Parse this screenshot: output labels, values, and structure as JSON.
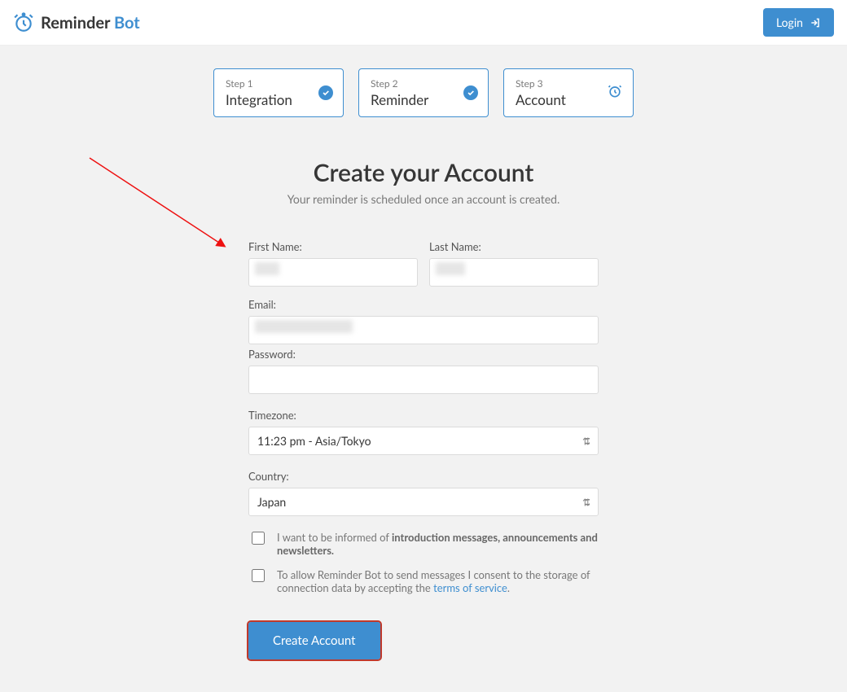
{
  "brand": {
    "name1": "Reminder",
    "name2": "Bot"
  },
  "login_label": "Login",
  "steps": [
    {
      "label": "Step 1",
      "title": "Integration",
      "state": "done"
    },
    {
      "label": "Step 2",
      "title": "Reminder",
      "state": "done"
    },
    {
      "label": "Step 3",
      "title": "Account",
      "state": "active"
    }
  ],
  "heading": "Create your Account",
  "subheading": "Your reminder is scheduled once an account is created.",
  "form": {
    "first_name": {
      "label": "First Name:",
      "value": ""
    },
    "last_name": {
      "label": "Last Name:",
      "value": ""
    },
    "email": {
      "label": "Email:",
      "value": ""
    },
    "password": {
      "label": "Password:",
      "value": ""
    },
    "timezone": {
      "label": "Timezone:",
      "value": "11:23 pm - Asia/Tokyo"
    },
    "country": {
      "label": "Country:",
      "value": "Japan"
    }
  },
  "consent": {
    "newsletter_prefix": "I want to be informed of ",
    "newsletter_bold": "introduction messages, announcements and newsletters.",
    "tos_prefix": "To allow Reminder Bot to send messages I consent to the storage of connection data by accepting the ",
    "tos_link": "terms of service",
    "tos_suffix": "."
  },
  "submit_label": "Create Account"
}
